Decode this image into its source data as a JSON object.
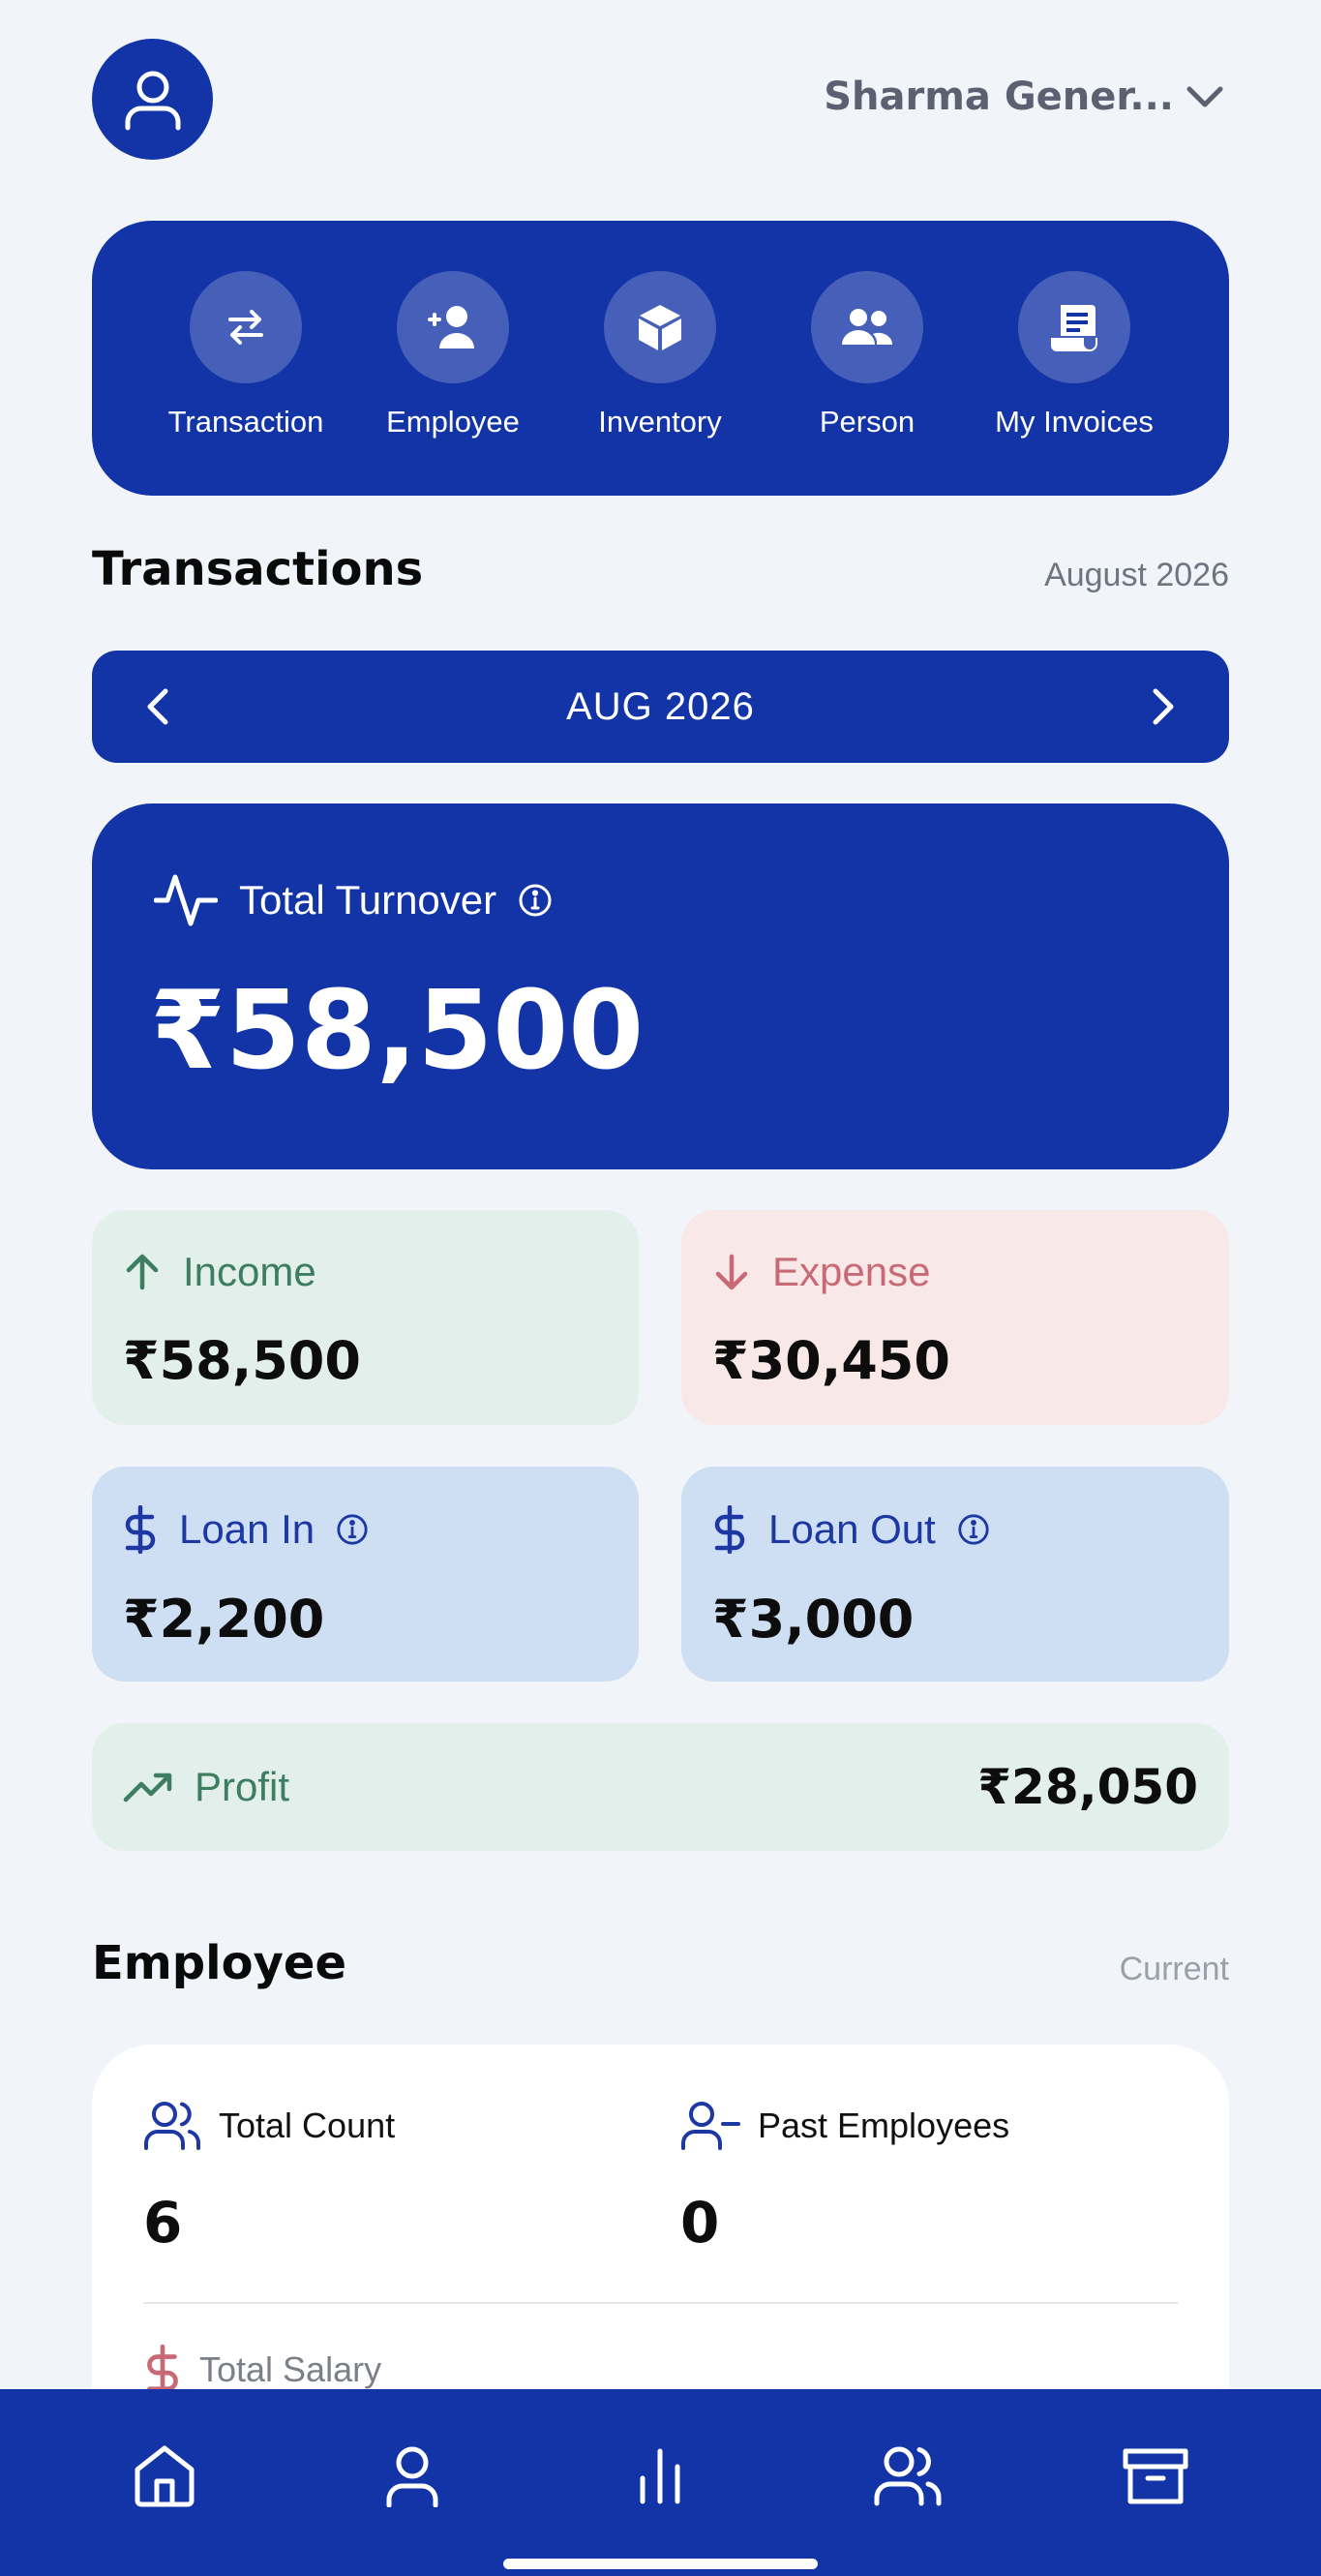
{
  "header": {
    "business_name": "Sharma Gener..."
  },
  "quick_actions": [
    {
      "label": "Transaction",
      "icon": "arrows-swap-icon"
    },
    {
      "label": "Employee",
      "icon": "user-plus-icon"
    },
    {
      "label": "Inventory",
      "icon": "box-icon"
    },
    {
      "label": "Person",
      "icon": "users-icon"
    },
    {
      "label": "My Invoices",
      "icon": "receipt-icon"
    }
  ],
  "transactions": {
    "title": "Transactions",
    "period": "August 2026",
    "month_label": "AUG 2026",
    "turnover_label": "Total Turnover",
    "turnover_value": "₹58,500",
    "income_label": "Income",
    "income_value": "₹58,500",
    "expense_label": "Expense",
    "expense_value": "₹30,450",
    "loan_in_label": "Loan In",
    "loan_in_value": "₹2,200",
    "loan_out_label": "Loan Out",
    "loan_out_value": "₹3,000",
    "profit_label": "Profit",
    "profit_value": "₹28,050"
  },
  "employee": {
    "title": "Employee",
    "filter": "Current",
    "total_count_label": "Total Count",
    "total_count_value": "6",
    "past_label": "Past Employees",
    "past_value": "0",
    "salary_label": "Total Salary"
  },
  "bottom_nav": [
    "home-icon",
    "user-icon",
    "bar-chart-icon",
    "users-icon",
    "archive-icon"
  ],
  "colors": {
    "primary": "#1234a6",
    "background": "#f1f4f9",
    "income": "#3d7d61",
    "expense": "#c86a76"
  }
}
